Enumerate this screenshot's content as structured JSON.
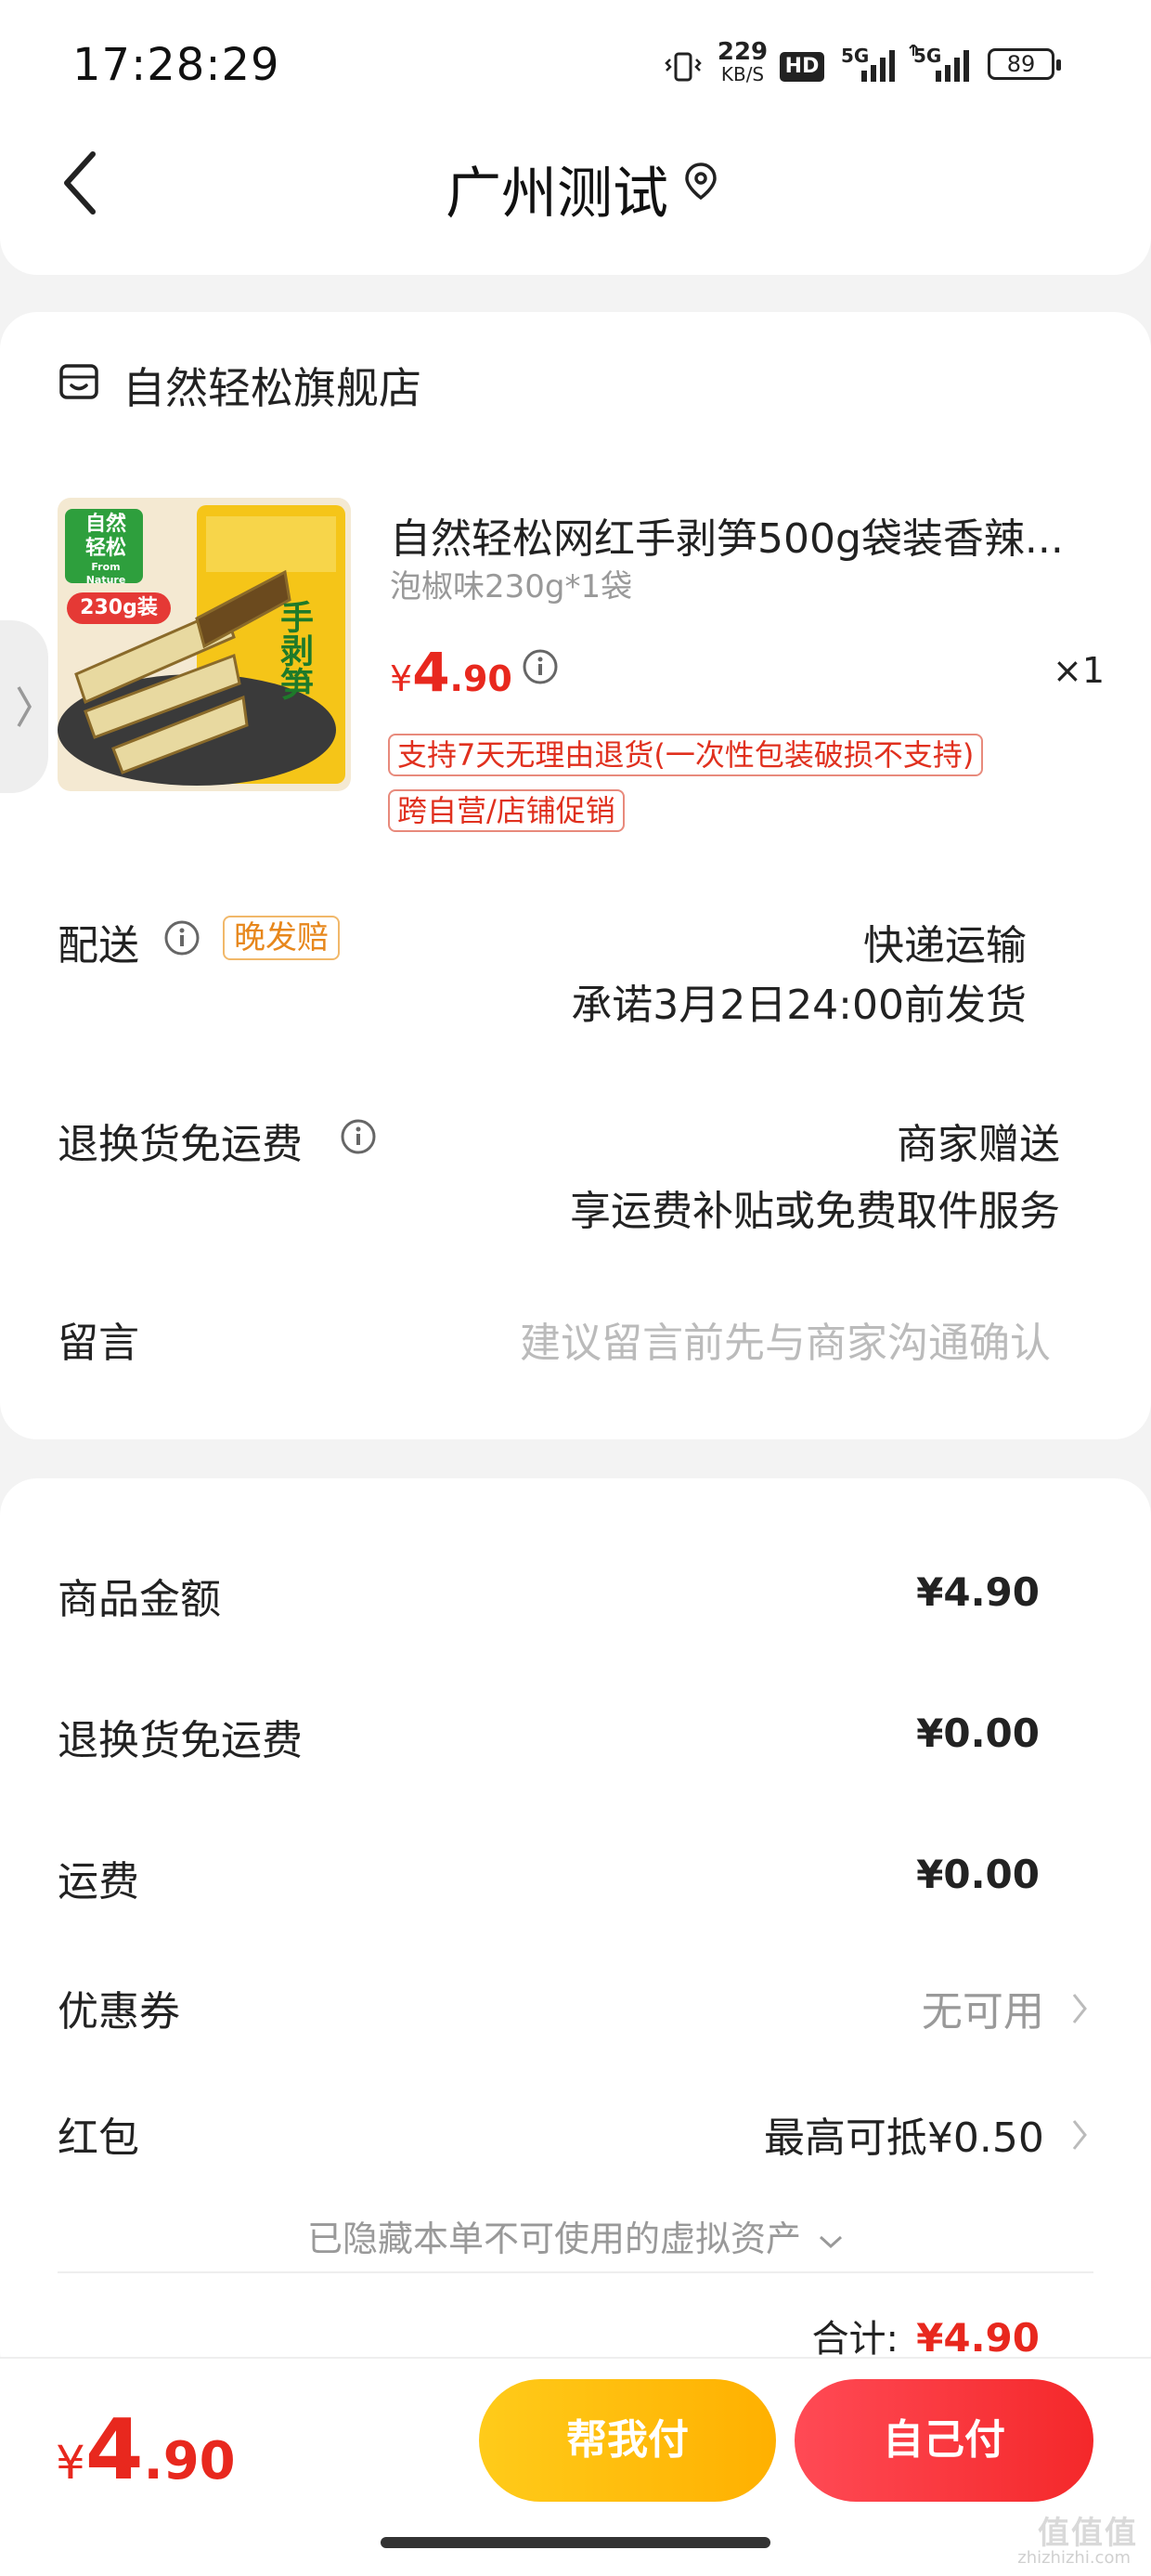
{
  "status_bar": {
    "time": "17:28:29",
    "net_speed_value": "229",
    "net_speed_unit": "KB/S",
    "hd": "HD",
    "sig1": "5G",
    "sig2": "5G",
    "battery": "89"
  },
  "header": {
    "back_icon": "chevron-left-icon",
    "title": "广州测试",
    "location_icon": "location-pin-icon"
  },
  "store": {
    "icon": "store-icon",
    "name": "自然轻松旗舰店"
  },
  "product": {
    "title": "自然轻松网红手剥笋500g袋装香辣...",
    "spec": "泡椒味230g*1袋",
    "price_currency": "¥",
    "price_int": "4",
    "price_dec": ".90",
    "qty": "×1",
    "tags": [
      "支持7天无理由退货(一次性包装破损不支持)",
      "跨自营/店铺促销"
    ],
    "image_text": {
      "brand_a": "自然",
      "brand_b": "轻松",
      "brand_en": "From Nature",
      "weight_badge": "230g装",
      "bag_text": "手剥笋"
    }
  },
  "side_tab": {
    "icon": "chevron-right-icon"
  },
  "delivery": {
    "label": "配送",
    "badge": "晚发赔",
    "method": "快递运输",
    "promise": "承诺3月2日24:00前发货"
  },
  "return_shipping": {
    "label": "退换货免运费",
    "value": "商家赠送",
    "desc": "享运费补贴或免费取件服务"
  },
  "message": {
    "label": "留言",
    "placeholder": "建议留言前先与商家沟通确认"
  },
  "summary": {
    "rows": [
      {
        "label": "商品金额",
        "value": "¥4.90"
      },
      {
        "label": "退换货免运费",
        "value": "¥0.00"
      },
      {
        "label": "运费",
        "value": "¥0.00"
      }
    ],
    "coupon_label": "优惠券",
    "coupon_value": "无可用",
    "redpacket_label": "红包",
    "redpacket_value": "最高可抵¥0.50",
    "hidden_assets": "已隐藏本单不可使用的虚拟资产",
    "total_label": "合计:",
    "total_value": "¥4.90"
  },
  "bottom": {
    "price_currency": "¥",
    "price_int": "4",
    "price_dec": ".90",
    "help_pay": "帮我付",
    "self_pay": "自己付"
  },
  "watermark": {
    "main": "值值值",
    "sub": "zhizhizhi.com"
  },
  "colors": {
    "accent_red": "#e8281e",
    "yellow_button": "#ffb000",
    "red_button": "#f4282a",
    "badge_orange": "#e7871c"
  }
}
